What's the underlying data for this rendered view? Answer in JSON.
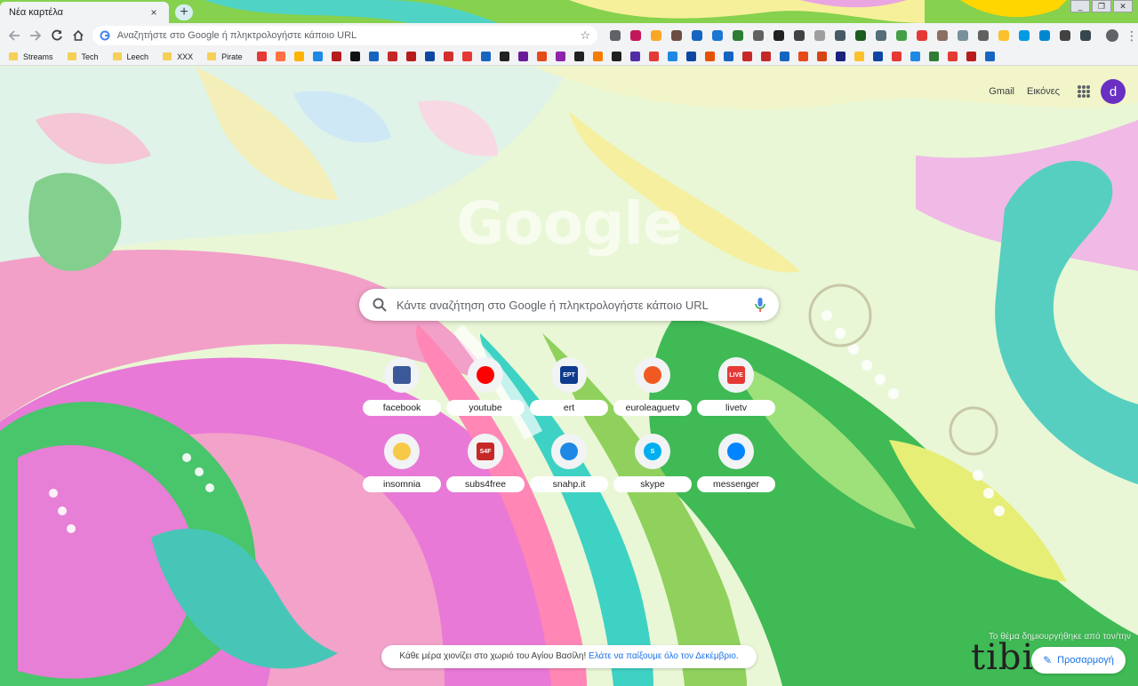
{
  "window": {
    "controls": [
      "_",
      "❐",
      "✕"
    ]
  },
  "tabs": [
    {
      "title": "Νέα καρτέλα",
      "close": "×"
    }
  ],
  "new_tab_symbol": "+",
  "toolbar": {
    "omnibox_placeholder": "Αναζητήστε στο Google ή πληκτρολογήστε κάποιο URL",
    "star": "☆",
    "extension_colors": [
      "#5f6368",
      "#c2185b",
      "#f9a825",
      "#6d4c41",
      "#1565c0",
      "#1976d2",
      "#2e7d32",
      "#616161",
      "#212121",
      "#424242",
      "#9e9e9e",
      "#455a64",
      "#1b5e20",
      "#546e7a",
      "#43a047",
      "#e53935",
      "#8d6e63",
      "#78909c",
      "#616161",
      "#fbc02d",
      "#039be5",
      "#0288d1",
      "#424242",
      "#37474f"
    ]
  },
  "bookmarks": {
    "folders": [
      "Streams",
      "Tech",
      "Leech",
      "XXX",
      "Pirate"
    ],
    "favicon_colors": [
      "#e53935",
      "#ff7043",
      "#ffb300",
      "#1e88e5",
      "#b71c1c",
      "#111111",
      "#1565c0",
      "#c62828",
      "#b71c1c",
      "#0d47a1",
      "#d32f2f",
      "#e53935",
      "#1565c0",
      "#212121",
      "#6a1b9a",
      "#e64a19",
      "#8e24aa",
      "#212121",
      "#f57c00",
      "#212121",
      "#512da8",
      "#e53935",
      "#1e88e5",
      "#0d47a1",
      "#e65100",
      "#1565c0",
      "#c62828",
      "#c62828",
      "#1565c0",
      "#e64a19",
      "#d84315",
      "#1a237e",
      "#fbc02d",
      "#0d47a1",
      "#e53935",
      "#1e88e5",
      "#2e7d32",
      "#e53935",
      "#b71c1c",
      "#1565c0"
    ]
  },
  "ntp": {
    "top_links": [
      "Gmail",
      "Εικόνες"
    ],
    "account_initial": "d",
    "logo_text": "Google",
    "search_placeholder": "Κάντε αναζήτηση στο Google ή πληκτρολογήστε κάποιο URL",
    "tiles": [
      {
        "label": "facebook",
        "icon": "facebook-icon",
        "color": "#3b5998"
      },
      {
        "label": "youtube",
        "icon": "youtube-icon",
        "color": "#ff0000"
      },
      {
        "label": "ert",
        "icon": "ert-icon",
        "color": "#0d3b8e",
        "glyph": "EPT"
      },
      {
        "label": "euroleaguetv",
        "icon": "euroleague-icon",
        "color": "#f05a22"
      },
      {
        "label": "livetv",
        "icon": "livetv-icon",
        "color": "#e53935",
        "glyph": "LIVE"
      },
      {
        "label": "insomnia",
        "icon": "insomnia-icon",
        "color": "#f7c948"
      },
      {
        "label": "subs4free",
        "icon": "subs4free-icon",
        "color": "#c62828",
        "glyph": "S4F"
      },
      {
        "label": "snahp.it",
        "icon": "snahp-icon",
        "color": "#1e88e5"
      },
      {
        "label": "skype",
        "icon": "skype-icon",
        "color": "#00aff0",
        "glyph": "S"
      },
      {
        "label": "messenger",
        "icon": "messenger-icon",
        "color": "#0084ff"
      }
    ],
    "promo_text": "Κάθε μέρα χιονίζει στο χωριό του Αγίου Βασίλη!",
    "promo_link": "Ελάτε να παίξουμε όλο τον Δεκέμβριο.",
    "attribution": "Το θέμα δημιουργήθηκε από τον/την",
    "artist": "tibi",
    "customize_label": "Προσαρμογή",
    "customize_icon": "✎"
  }
}
